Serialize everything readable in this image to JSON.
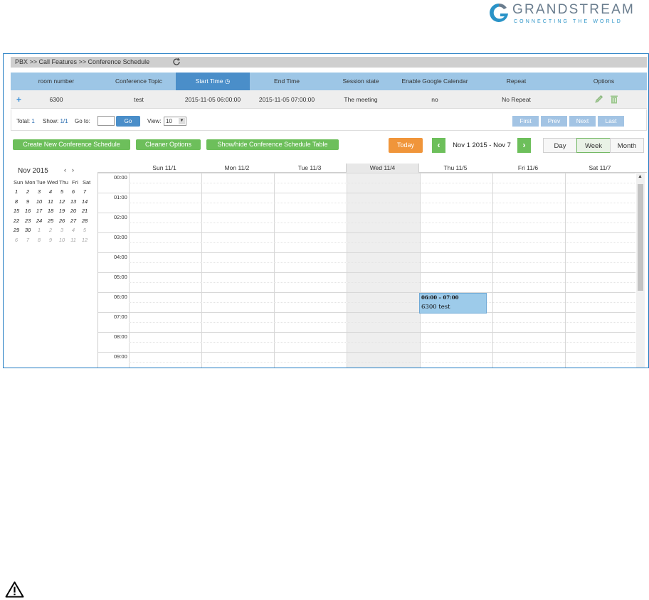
{
  "logo": {
    "word": "GRANDSTREAM",
    "tagline": "CONNECTING THE WORLD",
    "colors": {
      "blue": "#2a93c7",
      "gray": "#6a7d8e"
    }
  },
  "breadcrumb": "PBX >> Call Features >> Conference Schedule",
  "table": {
    "headers": [
      "room number",
      "Conference Topic",
      "Start Time",
      "End Time",
      "Session state",
      "Enable Google Calendar",
      "Repeat",
      "Options"
    ],
    "row": {
      "room_number": "6300",
      "topic": "test",
      "start": "2015-11-05 06:00:00",
      "end": "2015-11-05 07:00:00",
      "state": "The meeting",
      "google": "no",
      "repeat": "No Repeat"
    }
  },
  "pager": {
    "total_label": "Total:",
    "total": "1",
    "show_label": "Show:",
    "show": "1/1",
    "goto_label": "Go to:",
    "go": "Go",
    "view_label": "View:",
    "view": "10",
    "first": "First",
    "prev": "Prev",
    "next": "Next",
    "last": "Last"
  },
  "toolbar": {
    "create": "Create New Conference Schedule",
    "cleaner": "Cleaner Options",
    "toggle": "Show/hide Conference Schedule Table",
    "today": "Today",
    "range": "Nov 1 2015 - Nov 7",
    "day": "Day",
    "week": "Week",
    "month": "Month"
  },
  "mini_calendar": {
    "title": "Nov 2015",
    "prev": "‹",
    "next": "›",
    "dow": [
      "Sun",
      "Mon",
      "Tue",
      "Wed",
      "Thu",
      "Fri",
      "Sat"
    ],
    "weeks": [
      [
        "1",
        "2",
        "3",
        "4",
        "5",
        "6",
        "7"
      ],
      [
        "8",
        "9",
        "10",
        "11",
        "12",
        "13",
        "14"
      ],
      [
        "15",
        "16",
        "17",
        "18",
        "19",
        "20",
        "21"
      ],
      [
        "22",
        "23",
        "24",
        "25",
        "26",
        "27",
        "28"
      ],
      [
        "29",
        "30",
        "1",
        "2",
        "3",
        "4",
        "5"
      ],
      [
        "6",
        "7",
        "8",
        "9",
        "10",
        "11",
        "12"
      ]
    ]
  },
  "week": {
    "days": [
      "Sun 11/1",
      "Mon 11/2",
      "Tue 11/3",
      "Wed 11/4",
      "Thu 11/5",
      "Fri 11/6",
      "Sat 11/7"
    ],
    "hours": [
      "00:00",
      "01:00",
      "02:00",
      "03:00",
      "04:00",
      "05:00",
      "06:00",
      "07:00",
      "08:00",
      "09:00"
    ],
    "event": {
      "time": "06:00 – 07:00",
      "title": "6300 test"
    }
  }
}
